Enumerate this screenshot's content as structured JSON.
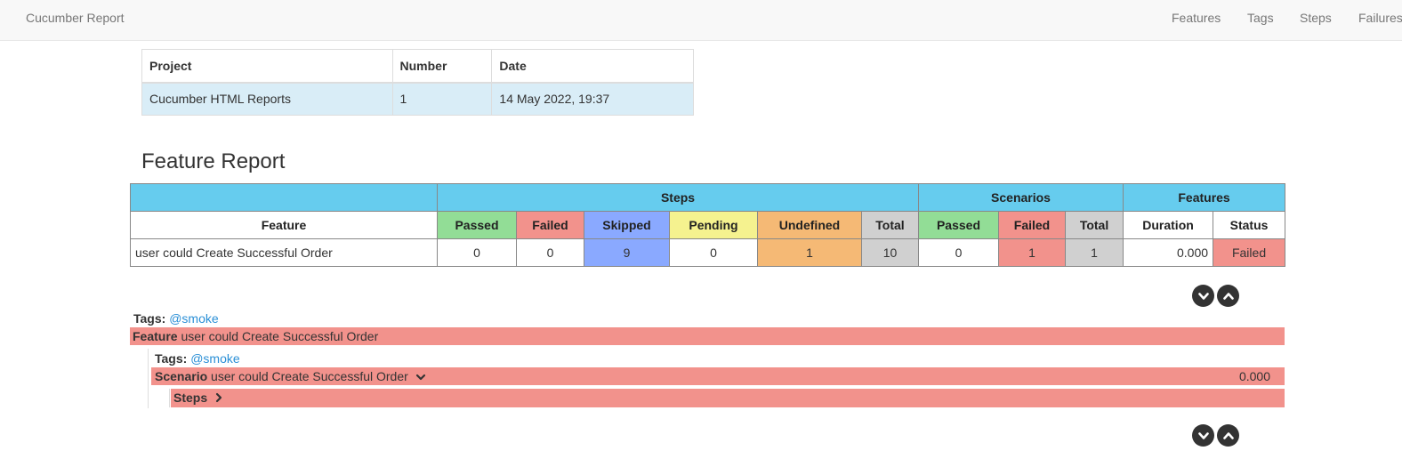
{
  "navbar": {
    "brand": "Cucumber Report",
    "links": [
      "Features",
      "Tags",
      "Steps",
      "Failures"
    ]
  },
  "info_table": {
    "headers": [
      "Project",
      "Number",
      "Date"
    ],
    "row": [
      "Cucumber HTML Reports",
      "1",
      "14 May 2022, 19:37"
    ]
  },
  "report": {
    "title": "Feature Report",
    "group_headers": {
      "steps": "Steps",
      "scenarios": "Scenarios",
      "features": "Features"
    },
    "columns": {
      "feature": "Feature",
      "steps_passed": "Passed",
      "steps_failed": "Failed",
      "steps_skipped": "Skipped",
      "steps_pending": "Pending",
      "steps_undefined": "Undefined",
      "steps_total": "Total",
      "scen_passed": "Passed",
      "scen_failed": "Failed",
      "scen_total": "Total",
      "duration": "Duration",
      "status": "Status"
    },
    "row": {
      "feature": "user could Create Successful Order",
      "steps_passed": "0",
      "steps_failed": "0",
      "steps_skipped": "9",
      "steps_pending": "0",
      "steps_undefined": "1",
      "steps_total": "10",
      "scen_passed": "0",
      "scen_failed": "1",
      "scen_total": "1",
      "duration": "0.000",
      "status": "Failed"
    }
  },
  "details": {
    "tags_label": "Tags:",
    "feature_tag": "@smoke",
    "feature_keyword": "Feature",
    "feature_name": "user could Create Successful Order",
    "scenario_tag": "@smoke",
    "scenario_keyword": "Scenario",
    "scenario_name": "user could Create Successful Order",
    "scenario_duration": "0.000",
    "steps_label": "Steps"
  },
  "colors": {
    "header": "#66ccee",
    "passed": "#92dd96",
    "failed": "#f2928c",
    "skipped": "#8aa9ff",
    "pending": "#f5f28f",
    "undefined": "#f5b975",
    "total": "#d0d0d0"
  },
  "icons": [
    "chevron-down-icon",
    "chevron-up-icon",
    "chevron-right-icon"
  ]
}
